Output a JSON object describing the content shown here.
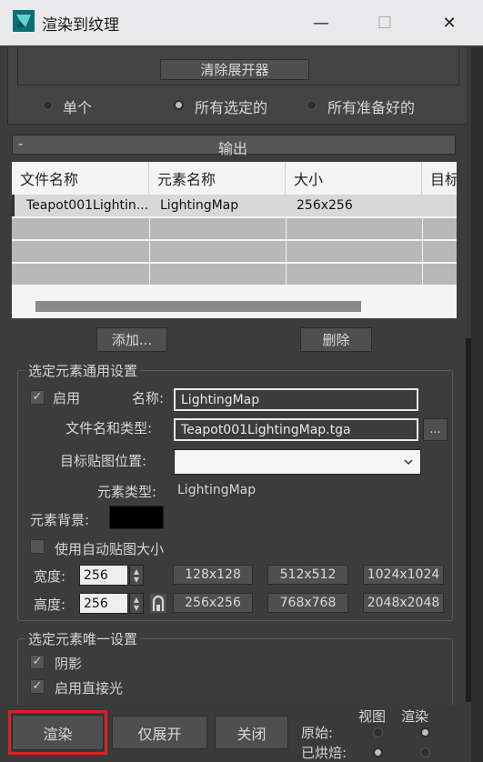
{
  "window": {
    "title": "渲染到纹理",
    "minimize_glyph": "—",
    "maximize_glyph": "☐",
    "close_glyph": "✕"
  },
  "top": {
    "clear_expander_label": "清除展开器",
    "radio_single": "单个",
    "radio_all_selected": "所有选定的",
    "radio_all_prepared": "所有准备好的"
  },
  "output": {
    "collapse_glyph": "-",
    "title": "输出",
    "columns": [
      "文件名称",
      "元素名称",
      "大小",
      "目标"
    ],
    "row": [
      "Teapot001Lightin...",
      "LightingMap",
      "256x256"
    ],
    "add_label": "添加...",
    "delete_label": "删除"
  },
  "common": {
    "group_title": "选定元素通用设置",
    "enable_label": "启用",
    "enable_check": "✓",
    "name_label": "名称:",
    "name_value": "LightingMap",
    "filename_label": "文件名和类型:",
    "filename_value": "Teapot001LightingMap.tga",
    "browse_label": "...",
    "target_pos_label": "目标贴图位置:",
    "target_pos_value": "",
    "element_type_label": "元素类型:",
    "element_type_value": "LightingMap",
    "element_bg_label": "元素背景:",
    "bg_color": "#000000",
    "auto_size_label": "使用自动贴图大小",
    "width_label": "宽度:",
    "width_value": "256",
    "height_label": "高度:",
    "height_value": "256",
    "sizes_row1": [
      "128x128",
      "512x512",
      "1024x1024"
    ],
    "sizes_row2": [
      "256x256",
      "768x768",
      "2048x2048"
    ]
  },
  "unique": {
    "group_title": "选定元素唯一设置",
    "shadow_label": "阴影",
    "direct_light_label": "启用直接光",
    "check": "✓"
  },
  "bottom": {
    "render_label": "渲染",
    "unwrap_label": "仅展开",
    "close_label": "关闭",
    "view_label": "视图",
    "render_col_label": "渲染",
    "original_label": "原始:",
    "baked_label": "已烘焙:",
    "highlight_color": "#e02020"
  }
}
